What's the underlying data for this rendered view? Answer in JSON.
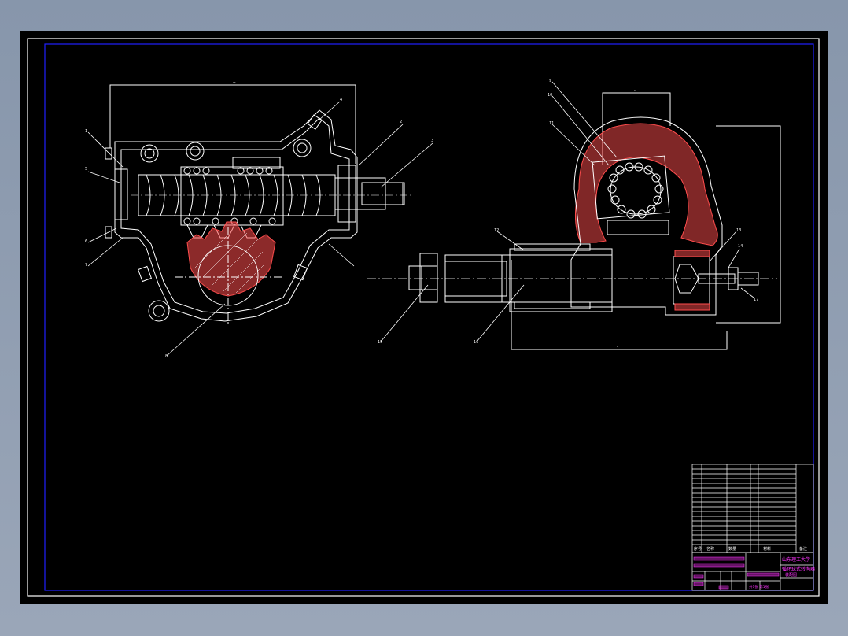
{
  "drawing": {
    "background": "#000000",
    "line_color": "#ffffff",
    "frame_color": "#1a1aff",
    "annotation_color": "#ff33ff",
    "hatch_color": "#ff4d4d"
  },
  "left_view": {
    "callouts": [
      "1",
      "2",
      "3",
      "4",
      "5",
      "6",
      "7",
      "8"
    ],
    "dimension": "--"
  },
  "right_view": {
    "callouts": [
      "9",
      "10",
      "11",
      "12",
      "13",
      "14",
      "15",
      "16",
      "17"
    ],
    "dimension_top": "-",
    "dimension_bottom": "-"
  },
  "title_block": {
    "header": [
      "序号",
      "名称",
      "数量",
      "材料",
      "备注"
    ],
    "school": "山东理工大学",
    "title_line1": "循环球式转向器",
    "title_line2": "装配图",
    "sheet_info": "共1张 第1张"
  }
}
